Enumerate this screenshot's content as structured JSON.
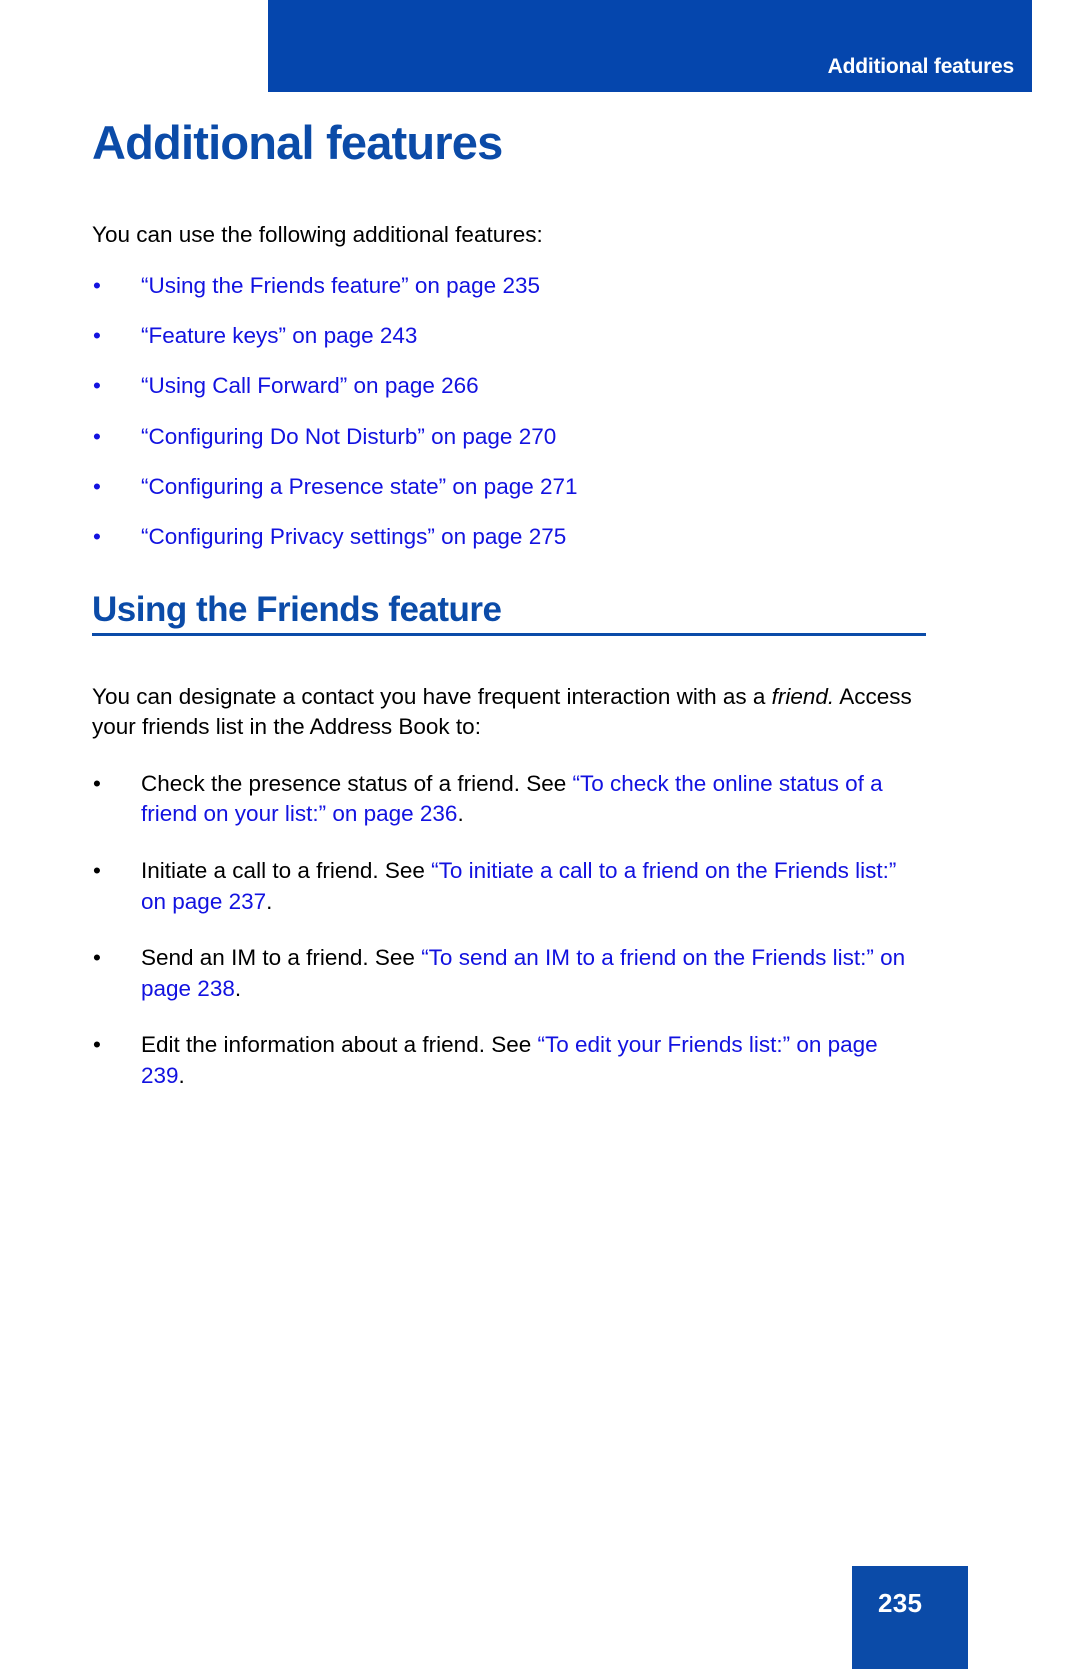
{
  "colors": {
    "brand_blue": "#0546ad",
    "heading_blue": "#0b4ba8",
    "link_blue": "#1212e0",
    "body_black": "#000000",
    "page_white": "#ffffff"
  },
  "header": {
    "running_title": "Additional features"
  },
  "page": {
    "title": "Additional features",
    "intro": "You can use the following additional features:",
    "bullet_glyph": "•"
  },
  "feature_links": [
    {
      "text": "“Using the Friends feature” on page 235"
    },
    {
      "text": "“Feature keys” on page 243"
    },
    {
      "text": "“Using Call Forward” on page 266"
    },
    {
      "text": "“Configuring Do Not Disturb” on page 270"
    },
    {
      "text": "“Configuring a Presence state” on page 271"
    },
    {
      "text": "“Configuring Privacy settings” on page 275"
    }
  ],
  "section": {
    "heading": "Using the Friends feature",
    "para_part1": "You can designate a contact you have frequent interaction with as a ",
    "para_italic": "friend.",
    "para_part2": " Access your friends list in the Address Book to:"
  },
  "friend_actions": [
    {
      "lead": "Check the presence status of a friend. See ",
      "link": "“To check the online status of a friend on your list:” on page 236",
      "tail": "."
    },
    {
      "lead": "Initiate a call to a friend. See ",
      "link": "“To initiate a call to a friend on the Friends list:” on page 237",
      "tail": "."
    },
    {
      "lead": "Send an IM to a friend. See ",
      "link": "“To send an IM to a friend on the Friends list:” on page 238",
      "tail": "."
    },
    {
      "lead": "Edit the information about a friend. See ",
      "link": "“To edit your Friends list:” on page 239",
      "tail": "."
    }
  ],
  "footer": {
    "page_number": "235"
  }
}
